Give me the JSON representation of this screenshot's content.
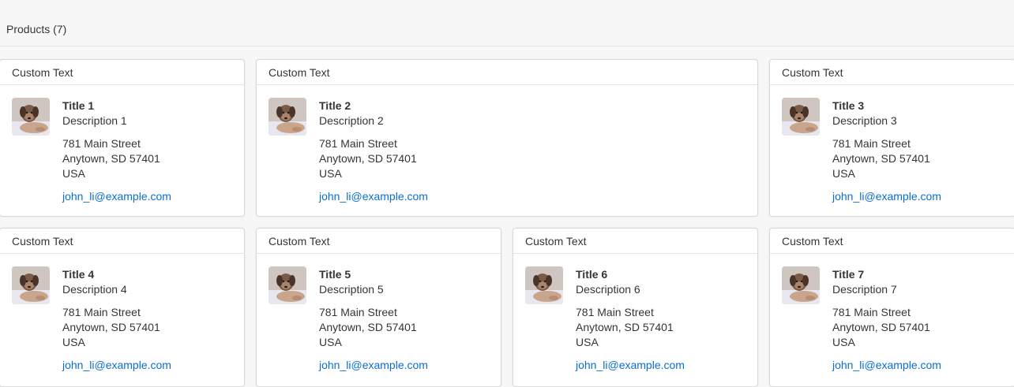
{
  "toolbar": {
    "title": "Products (7)"
  },
  "cards": [
    {
      "header": "Custom Text",
      "title": "Title 1",
      "description": "Description 1",
      "street": "781 Main Street",
      "city": "Anytown, SD 57401",
      "country": "USA",
      "email": "john_li@example.com"
    },
    {
      "header": "Custom Text",
      "title": "Title 2",
      "description": "Description 2",
      "street": "781 Main Street",
      "city": "Anytown, SD 57401",
      "country": "USA",
      "email": "john_li@example.com"
    },
    {
      "header": "Custom Text",
      "title": "Title 3",
      "description": "Description 3",
      "street": "781 Main Street",
      "city": "Anytown, SD 57401",
      "country": "USA",
      "email": "john_li@example.com"
    },
    {
      "header": "Custom Text",
      "title": "Title 4",
      "description": "Description 4",
      "street": "781 Main Street",
      "city": "Anytown, SD 57401",
      "country": "USA",
      "email": "john_li@example.com"
    },
    {
      "header": "Custom Text",
      "title": "Title 5",
      "description": "Description 5",
      "street": "781 Main Street",
      "city": "Anytown, SD 57401",
      "country": "USA",
      "email": "john_li@example.com"
    },
    {
      "header": "Custom Text",
      "title": "Title 6",
      "description": "Description 6",
      "street": "781 Main Street",
      "city": "Anytown, SD 57401",
      "country": "USA",
      "email": "john_li@example.com"
    },
    {
      "header": "Custom Text",
      "title": "Title 7",
      "description": "Description 7",
      "street": "781 Main Street",
      "city": "Anytown, SD 57401",
      "country": "USA",
      "email": "john_li@example.com"
    }
  ],
  "colors": {
    "link": "#0a6ed1",
    "border": "#d9d9d9",
    "background": "#f7f7f7"
  },
  "icons": {
    "thumbnail": "dog-photo-thumbnail"
  }
}
